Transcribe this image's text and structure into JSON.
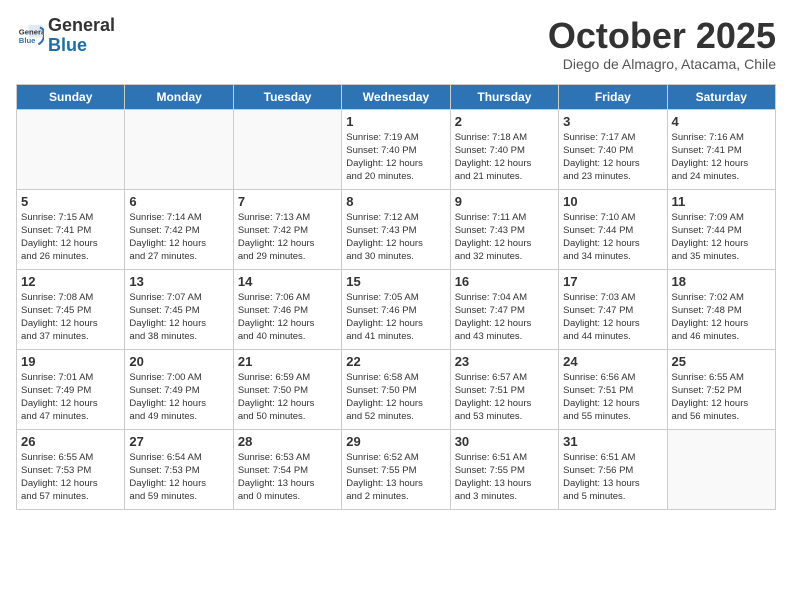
{
  "header": {
    "logo_line1": "General",
    "logo_line2": "Blue",
    "month_title": "October 2025",
    "subtitle": "Diego de Almagro, Atacama, Chile"
  },
  "weekdays": [
    "Sunday",
    "Monday",
    "Tuesday",
    "Wednesday",
    "Thursday",
    "Friday",
    "Saturday"
  ],
  "weeks": [
    [
      {
        "day": "",
        "info": ""
      },
      {
        "day": "",
        "info": ""
      },
      {
        "day": "",
        "info": ""
      },
      {
        "day": "1",
        "info": "Sunrise: 7:19 AM\nSunset: 7:40 PM\nDaylight: 12 hours\nand 20 minutes."
      },
      {
        "day": "2",
        "info": "Sunrise: 7:18 AM\nSunset: 7:40 PM\nDaylight: 12 hours\nand 21 minutes."
      },
      {
        "day": "3",
        "info": "Sunrise: 7:17 AM\nSunset: 7:40 PM\nDaylight: 12 hours\nand 23 minutes."
      },
      {
        "day": "4",
        "info": "Sunrise: 7:16 AM\nSunset: 7:41 PM\nDaylight: 12 hours\nand 24 minutes."
      }
    ],
    [
      {
        "day": "5",
        "info": "Sunrise: 7:15 AM\nSunset: 7:41 PM\nDaylight: 12 hours\nand 26 minutes."
      },
      {
        "day": "6",
        "info": "Sunrise: 7:14 AM\nSunset: 7:42 PM\nDaylight: 12 hours\nand 27 minutes."
      },
      {
        "day": "7",
        "info": "Sunrise: 7:13 AM\nSunset: 7:42 PM\nDaylight: 12 hours\nand 29 minutes."
      },
      {
        "day": "8",
        "info": "Sunrise: 7:12 AM\nSunset: 7:43 PM\nDaylight: 12 hours\nand 30 minutes."
      },
      {
        "day": "9",
        "info": "Sunrise: 7:11 AM\nSunset: 7:43 PM\nDaylight: 12 hours\nand 32 minutes."
      },
      {
        "day": "10",
        "info": "Sunrise: 7:10 AM\nSunset: 7:44 PM\nDaylight: 12 hours\nand 34 minutes."
      },
      {
        "day": "11",
        "info": "Sunrise: 7:09 AM\nSunset: 7:44 PM\nDaylight: 12 hours\nand 35 minutes."
      }
    ],
    [
      {
        "day": "12",
        "info": "Sunrise: 7:08 AM\nSunset: 7:45 PM\nDaylight: 12 hours\nand 37 minutes."
      },
      {
        "day": "13",
        "info": "Sunrise: 7:07 AM\nSunset: 7:45 PM\nDaylight: 12 hours\nand 38 minutes."
      },
      {
        "day": "14",
        "info": "Sunrise: 7:06 AM\nSunset: 7:46 PM\nDaylight: 12 hours\nand 40 minutes."
      },
      {
        "day": "15",
        "info": "Sunrise: 7:05 AM\nSunset: 7:46 PM\nDaylight: 12 hours\nand 41 minutes."
      },
      {
        "day": "16",
        "info": "Sunrise: 7:04 AM\nSunset: 7:47 PM\nDaylight: 12 hours\nand 43 minutes."
      },
      {
        "day": "17",
        "info": "Sunrise: 7:03 AM\nSunset: 7:47 PM\nDaylight: 12 hours\nand 44 minutes."
      },
      {
        "day": "18",
        "info": "Sunrise: 7:02 AM\nSunset: 7:48 PM\nDaylight: 12 hours\nand 46 minutes."
      }
    ],
    [
      {
        "day": "19",
        "info": "Sunrise: 7:01 AM\nSunset: 7:49 PM\nDaylight: 12 hours\nand 47 minutes."
      },
      {
        "day": "20",
        "info": "Sunrise: 7:00 AM\nSunset: 7:49 PM\nDaylight: 12 hours\nand 49 minutes."
      },
      {
        "day": "21",
        "info": "Sunrise: 6:59 AM\nSunset: 7:50 PM\nDaylight: 12 hours\nand 50 minutes."
      },
      {
        "day": "22",
        "info": "Sunrise: 6:58 AM\nSunset: 7:50 PM\nDaylight: 12 hours\nand 52 minutes."
      },
      {
        "day": "23",
        "info": "Sunrise: 6:57 AM\nSunset: 7:51 PM\nDaylight: 12 hours\nand 53 minutes."
      },
      {
        "day": "24",
        "info": "Sunrise: 6:56 AM\nSunset: 7:51 PM\nDaylight: 12 hours\nand 55 minutes."
      },
      {
        "day": "25",
        "info": "Sunrise: 6:55 AM\nSunset: 7:52 PM\nDaylight: 12 hours\nand 56 minutes."
      }
    ],
    [
      {
        "day": "26",
        "info": "Sunrise: 6:55 AM\nSunset: 7:53 PM\nDaylight: 12 hours\nand 57 minutes."
      },
      {
        "day": "27",
        "info": "Sunrise: 6:54 AM\nSunset: 7:53 PM\nDaylight: 12 hours\nand 59 minutes."
      },
      {
        "day": "28",
        "info": "Sunrise: 6:53 AM\nSunset: 7:54 PM\nDaylight: 13 hours\nand 0 minutes."
      },
      {
        "day": "29",
        "info": "Sunrise: 6:52 AM\nSunset: 7:55 PM\nDaylight: 13 hours\nand 2 minutes."
      },
      {
        "day": "30",
        "info": "Sunrise: 6:51 AM\nSunset: 7:55 PM\nDaylight: 13 hours\nand 3 minutes."
      },
      {
        "day": "31",
        "info": "Sunrise: 6:51 AM\nSunset: 7:56 PM\nDaylight: 13 hours\nand 5 minutes."
      },
      {
        "day": "",
        "info": ""
      }
    ]
  ]
}
